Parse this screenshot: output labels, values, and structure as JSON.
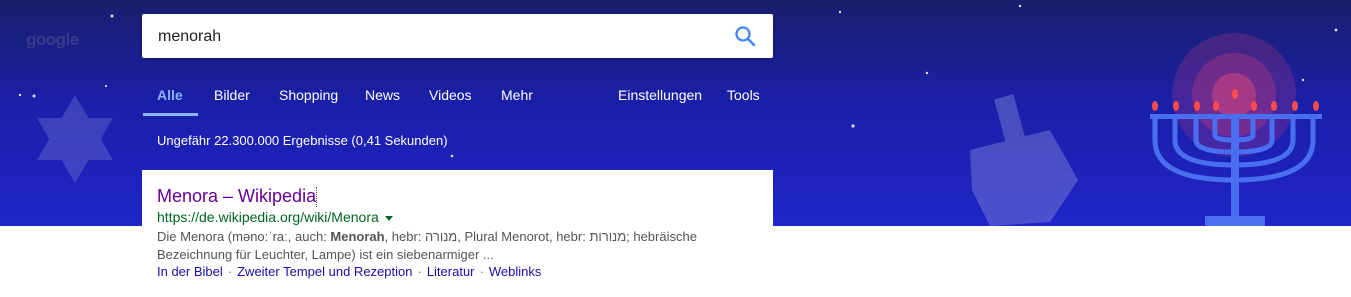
{
  "logo": {
    "text": "google"
  },
  "search": {
    "query": "menorah",
    "placeholder": ""
  },
  "tabs": [
    {
      "label": "Alle",
      "active": true
    },
    {
      "label": "Bilder"
    },
    {
      "label": "Shopping"
    },
    {
      "label": "News"
    },
    {
      "label": "Videos"
    },
    {
      "label": "Mehr"
    }
  ],
  "tools": {
    "settings_label": "Einstellungen",
    "tools_label": "Tools"
  },
  "stats": "Ungefähr 22.300.000 Ergebnisse (0,41 Sekunden)",
  "result": {
    "title": "Menora – Wikipedia",
    "url": "https://de.wikipedia.org/wiki/Menora",
    "snippet_line1_a": "Die Menora (məno:ˈraː, auch: ",
    "snippet_bold": "Menorah",
    "snippet_line1_b": ", hebr: מנורה, Plural Menorot, hebr: מנורות; hebräische",
    "snippet_line2": "Bezeichnung für Leuchter, Lampe) ist ein siebenarmiger ...",
    "sitelinks": [
      "In der Bibel",
      "Zweiter Tempel und Rezeption",
      "Literatur",
      "Weblinks"
    ]
  },
  "colors": {
    "banner_top": "#1a1f6e",
    "banner_bottom": "#1f25c7",
    "active_tab": "#8ab4f8",
    "title_visited": "#660099",
    "url_green": "#006621",
    "link_blue": "#1a0dab"
  },
  "icons": [
    "search-icon",
    "star-of-david-icon",
    "dreidel-icon",
    "menorah-icon",
    "url-dropdown-icon"
  ]
}
